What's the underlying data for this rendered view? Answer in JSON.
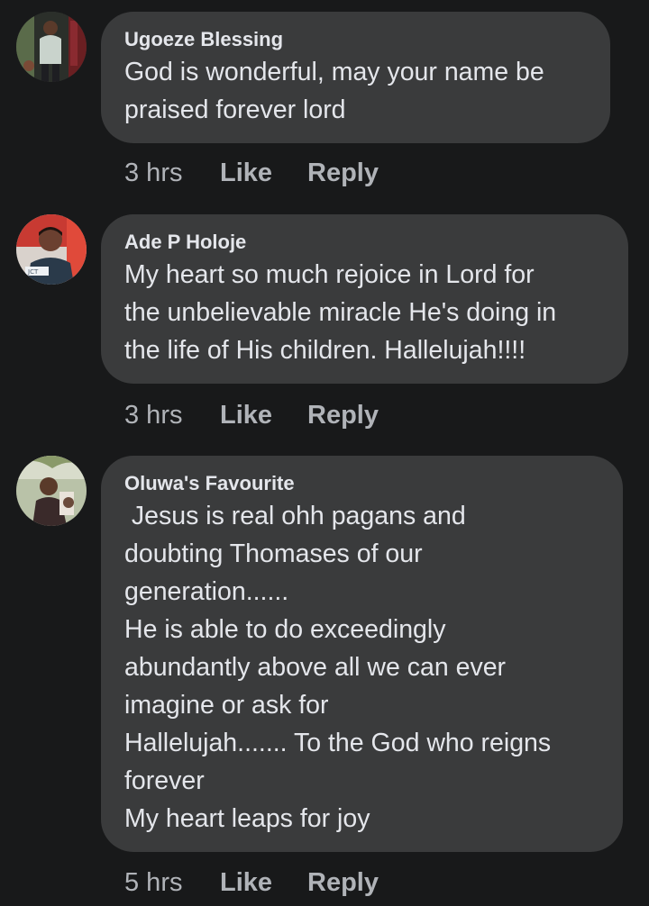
{
  "comments": [
    {
      "author": "Ugoeze Blessing",
      "text": "God is wonderful, may your name be\npraised forever lord",
      "time": "3 hrs",
      "like_label": "Like",
      "reply_label": "Reply"
    },
    {
      "author": "Ade P Holoje",
      "text": "My heart so much rejoice in Lord for\nthe unbelievable miracle He's doing in\nthe life of His children. Hallelujah!!!!",
      "time": "3 hrs",
      "like_label": "Like",
      "reply_label": "Reply"
    },
    {
      "author": "Oluwa's Favourite",
      "text": " Jesus is real ohh pagans and\ndoubting Thomases of our\ngeneration......\nHe is able to do exceedingly\nabundantly above all we can ever\nimagine or ask for\nHallelujah....... To the God who reigns\nforever\nMy heart leaps for joy",
      "time": "5 hrs",
      "like_label": "Like",
      "reply_label": "Reply"
    }
  ],
  "colors": {
    "background": "#18191a",
    "bubble": "#3a3b3c",
    "text": "#e4e6eb",
    "secondary_text": "#b0b3b8"
  }
}
